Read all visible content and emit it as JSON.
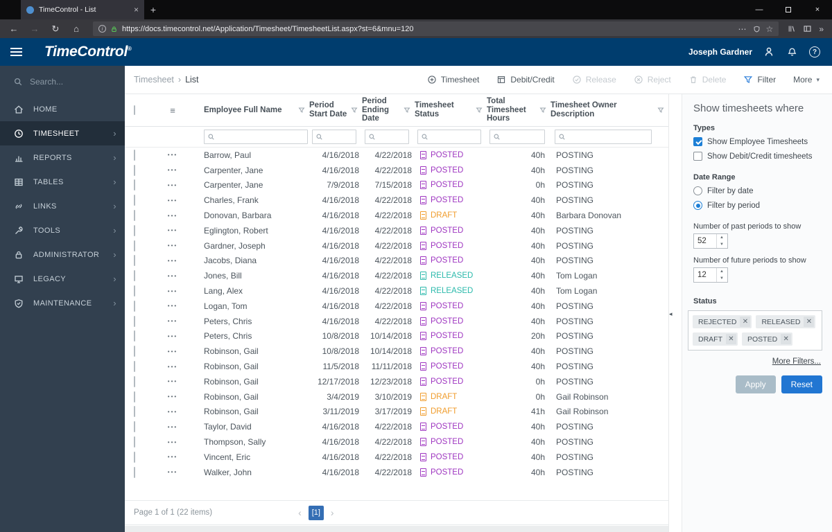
{
  "browser": {
    "tab_title": "TimeControl - List",
    "url": "https://docs.timecontrol.net/Application/Timesheet/TimesheetList.aspx?st=6&mnu=120"
  },
  "header": {
    "logo_text": "TimeControl",
    "registered_mark": "®",
    "user_name": "Joseph Gardner"
  },
  "sidebar": {
    "search_placeholder": "Search...",
    "items": [
      {
        "label": "HOME"
      },
      {
        "label": "TIMESHEET"
      },
      {
        "label": "REPORTS"
      },
      {
        "label": "TABLES"
      },
      {
        "label": "LINKS"
      },
      {
        "label": "TOOLS"
      },
      {
        "label": "ADMINISTRATOR"
      },
      {
        "label": "LEGACY"
      },
      {
        "label": "MAINTENANCE"
      }
    ]
  },
  "breadcrumb": {
    "section": "Timesheet",
    "separator": "›",
    "page": "List"
  },
  "toolbar": {
    "timesheet": "Timesheet",
    "debit_credit": "Debit/Credit",
    "release": "Release",
    "reject": "Reject",
    "delete": "Delete",
    "filter": "Filter",
    "more": "More"
  },
  "table": {
    "columns": [
      "Employee Full Name",
      "Period Start Date",
      "Period Ending Date",
      "Timesheet Status",
      "Total Timesheet Hours",
      "Timesheet Owner Description"
    ],
    "rows": [
      {
        "name": "Barrow, Paul",
        "start": "4/16/2018",
        "end": "4/22/2018",
        "status": "POSTED",
        "hours": "40h",
        "owner": "POSTING"
      },
      {
        "name": "Carpenter, Jane",
        "start": "4/16/2018",
        "end": "4/22/2018",
        "status": "POSTED",
        "hours": "40h",
        "owner": "POSTING"
      },
      {
        "name": "Carpenter, Jane",
        "start": "7/9/2018",
        "end": "7/15/2018",
        "status": "POSTED",
        "hours": "0h",
        "owner": "POSTING"
      },
      {
        "name": "Charles, Frank",
        "start": "4/16/2018",
        "end": "4/22/2018",
        "status": "POSTED",
        "hours": "40h",
        "owner": "POSTING"
      },
      {
        "name": "Donovan, Barbara",
        "start": "4/16/2018",
        "end": "4/22/2018",
        "status": "DRAFT",
        "hours": "40h",
        "owner": "Barbara Donovan"
      },
      {
        "name": "Eglington, Robert",
        "start": "4/16/2018",
        "end": "4/22/2018",
        "status": "POSTED",
        "hours": "40h",
        "owner": "POSTING"
      },
      {
        "name": "Gardner, Joseph",
        "start": "4/16/2018",
        "end": "4/22/2018",
        "status": "POSTED",
        "hours": "40h",
        "owner": "POSTING"
      },
      {
        "name": "Jacobs, Diana",
        "start": "4/16/2018",
        "end": "4/22/2018",
        "status": "POSTED",
        "hours": "40h",
        "owner": "POSTING"
      },
      {
        "name": "Jones, Bill",
        "start": "4/16/2018",
        "end": "4/22/2018",
        "status": "RELEASED",
        "hours": "40h",
        "owner": "Tom Logan"
      },
      {
        "name": "Lang, Alex",
        "start": "4/16/2018",
        "end": "4/22/2018",
        "status": "RELEASED",
        "hours": "40h",
        "owner": "Tom Logan"
      },
      {
        "name": "Logan, Tom",
        "start": "4/16/2018",
        "end": "4/22/2018",
        "status": "POSTED",
        "hours": "40h",
        "owner": "POSTING"
      },
      {
        "name": "Peters, Chris",
        "start": "4/16/2018",
        "end": "4/22/2018",
        "status": "POSTED",
        "hours": "40h",
        "owner": "POSTING"
      },
      {
        "name": "Peters, Chris",
        "start": "10/8/2018",
        "end": "10/14/2018",
        "status": "POSTED",
        "hours": "20h",
        "owner": "POSTING"
      },
      {
        "name": "Robinson, Gail",
        "start": "10/8/2018",
        "end": "10/14/2018",
        "status": "POSTED",
        "hours": "40h",
        "owner": "POSTING"
      },
      {
        "name": "Robinson, Gail",
        "start": "11/5/2018",
        "end": "11/11/2018",
        "status": "POSTED",
        "hours": "40h",
        "owner": "POSTING"
      },
      {
        "name": "Robinson, Gail",
        "start": "12/17/2018",
        "end": "12/23/2018",
        "status": "POSTED",
        "hours": "0h",
        "owner": "POSTING"
      },
      {
        "name": "Robinson, Gail",
        "start": "3/4/2019",
        "end": "3/10/2019",
        "status": "DRAFT",
        "hours": "0h",
        "owner": "Gail Robinson"
      },
      {
        "name": "Robinson, Gail",
        "start": "3/11/2019",
        "end": "3/17/2019",
        "status": "DRAFT",
        "hours": "41h",
        "owner": "Gail Robinson"
      },
      {
        "name": "Taylor, David",
        "start": "4/16/2018",
        "end": "4/22/2018",
        "status": "POSTED",
        "hours": "40h",
        "owner": "POSTING"
      },
      {
        "name": "Thompson, Sally",
        "start": "4/16/2018",
        "end": "4/22/2018",
        "status": "POSTED",
        "hours": "40h",
        "owner": "POSTING"
      },
      {
        "name": "Vincent, Eric",
        "start": "4/16/2018",
        "end": "4/22/2018",
        "status": "POSTED",
        "hours": "40h",
        "owner": "POSTING"
      },
      {
        "name": "Walker, John",
        "start": "4/16/2018",
        "end": "4/22/2018",
        "status": "POSTED",
        "hours": "40h",
        "owner": "POSTING"
      }
    ]
  },
  "pagination": {
    "summary": "Page 1 of 1 (22 items)",
    "current_label": "[1]"
  },
  "panel": {
    "title": "Show timesheets where",
    "types_label": "Types",
    "type_options": [
      {
        "label": "Show Employee Timesheets",
        "checked": true
      },
      {
        "label": "Show Debit/Credit timesheets",
        "checked": false
      }
    ],
    "date_range_label": "Date Range",
    "date_options": [
      {
        "label": "Filter by date",
        "selected": false
      },
      {
        "label": "Filter by period",
        "selected": true
      }
    ],
    "past_periods_label": "Number of past periods to show",
    "past_periods_value": "52",
    "future_periods_label": "Number of future periods to show",
    "future_periods_value": "12",
    "status_label": "Status",
    "status_chips": [
      "REJECTED",
      "RELEASED",
      "DRAFT",
      "POSTED"
    ],
    "more_filters_label": "More Filters...",
    "apply_label": "Apply",
    "reset_label": "Reset"
  },
  "colors": {
    "status": {
      "POSTED": "#9e35c0",
      "DRAFT": "#f09c2c",
      "RELEASED": "#2ab9ab"
    },
    "accent_blue": "#2176d2",
    "header_navy": "#003d6e",
    "sidebar_dark": "#32404f",
    "pager_active": "#346eb4"
  }
}
